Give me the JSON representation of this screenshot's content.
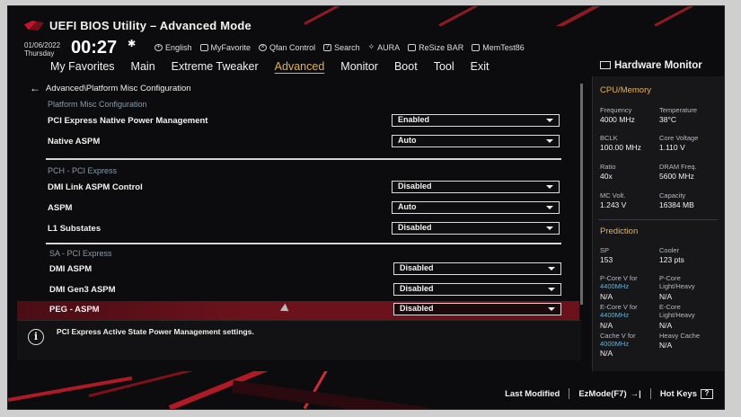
{
  "header": {
    "title": "UEFI BIOS Utility – Advanced Mode",
    "date": "01/06/2022",
    "day": "Thursday",
    "time": "00:27",
    "tools": [
      {
        "icon": "globe-icon",
        "label": "English"
      },
      {
        "icon": "favorite-icon",
        "label": "MyFavorite"
      },
      {
        "icon": "fan-icon",
        "label": "Qfan Control"
      },
      {
        "icon": "search-icon",
        "label": "Search"
      },
      {
        "icon": "aura-icon",
        "label": "AURA"
      },
      {
        "icon": "resize-bar-icon",
        "label": "ReSize BAR"
      },
      {
        "icon": "memtest-icon",
        "label": "MemTest86"
      }
    ]
  },
  "nav": {
    "tabs": [
      "My Favorites",
      "Main",
      "Extreme Tweaker",
      "Advanced",
      "Monitor",
      "Boot",
      "Tool",
      "Exit"
    ],
    "active": "Advanced"
  },
  "main": {
    "breadcrumb": "Advanced\\Platform Misc Configuration",
    "sections": {
      "platform": "Platform Misc Configuration",
      "pch": "PCH - PCI Express",
      "sa": "SA - PCI Express"
    },
    "settings": [
      {
        "label": "PCI Express Native Power Management",
        "value": "Enabled"
      },
      {
        "label": "Native ASPM",
        "value": "Auto"
      },
      {
        "label": "DMI Link ASPM Control",
        "value": "Disabled"
      },
      {
        "label": "ASPM",
        "value": "Auto"
      },
      {
        "label": "L1 Substates",
        "value": "Disabled"
      },
      {
        "label": "DMI ASPM",
        "value": "Disabled"
      },
      {
        "label": "DMI Gen3 ASPM",
        "value": "Disabled"
      },
      {
        "label": "PEG - ASPM",
        "value": "Disabled"
      }
    ],
    "help_text": "PCI Express Active State Power Management settings."
  },
  "hardware_monitor": {
    "title": "Hardware Monitor",
    "cpu_memory": {
      "heading": "CPU/Memory",
      "frequency": {
        "label": "Frequency",
        "value": "4000 MHz"
      },
      "temperature": {
        "label": "Temperature",
        "value": "38°C"
      },
      "bclk": {
        "label": "BCLK",
        "value": "100.00 MHz"
      },
      "core_voltage": {
        "label": "Core Voltage",
        "value": "1.110 V"
      },
      "ratio": {
        "label": "Ratio",
        "value": "40x"
      },
      "dram_freq": {
        "label": "DRAM Freq.",
        "value": "5600 MHz"
      },
      "mc_volt": {
        "label": "MC Volt.",
        "value": "1.243 V"
      },
      "capacity": {
        "label": "Capacity",
        "value": "16384 MB"
      }
    },
    "prediction": {
      "heading": "Prediction",
      "sp": {
        "label": "SP",
        "value": "153"
      },
      "cooler": {
        "label": "Cooler",
        "value": "123 pts"
      },
      "pcore_v": {
        "label": "P-Core V for",
        "freq": "4400MHz",
        "value": "N/A"
      },
      "pcore_lh": {
        "label1": "P-Core",
        "label2": "Light/Heavy",
        "value": "N/A"
      },
      "ecore_v": {
        "label": "E-Core V for",
        "freq": "4400MHz",
        "value": "N/A"
      },
      "ecore_lh": {
        "label1": "E-Core",
        "label2": "Light/Heavy",
        "value": "N/A"
      },
      "cache_v": {
        "label": "Cache V for",
        "freq": "4000MHz",
        "value": "N/A"
      },
      "heavy_cache": {
        "label": "Heavy Cache",
        "value": "N/A"
      }
    }
  },
  "footer": {
    "last_modified": "Last Modified",
    "ezmode": "EzMode(F7)",
    "ezmode_icon": "→|",
    "hotkeys": "Hot Keys",
    "hotkeys_icon": "?"
  },
  "colors": {
    "accent": "#e5b04c",
    "selection": "#6b121c",
    "info_blue": "#51b8e8"
  }
}
